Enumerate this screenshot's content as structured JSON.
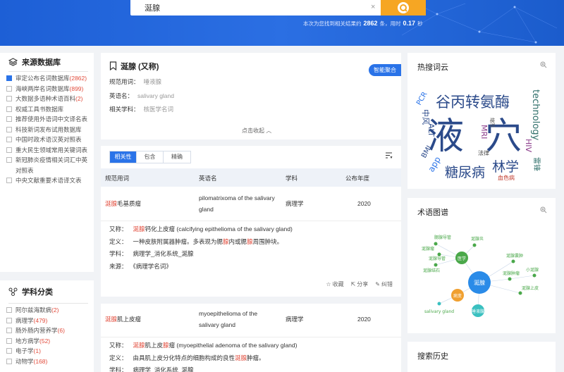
{
  "search": {
    "value": "涎腺",
    "clear": "×"
  },
  "stats": {
    "prefix": "本次为您找到相关结果约",
    "count": "2862",
    "mid": "条，用时",
    "time": "0.17",
    "suffix": "秒"
  },
  "sources": {
    "title": "来源数据库",
    "items": [
      {
        "label": "审定公布名词数据库",
        "count": "(2862)",
        "checked": true
      },
      {
        "label": "海峡两岸名词数据库",
        "count": "(899)",
        "checked": false
      },
      {
        "label": "大数据多语种术语百科",
        "count": "(2)",
        "checked": false
      },
      {
        "label": "权威工具书数据库",
        "count": "",
        "checked": false
      },
      {
        "label": "推荐使用外语词中文译名表",
        "count": "",
        "checked": false
      },
      {
        "label": "科技新词发布试用数据库",
        "count": "",
        "checked": false
      },
      {
        "label": "中国时政术语汉英对照表",
        "count": "",
        "checked": false
      },
      {
        "label": "重大民生领域常用关键词表",
        "count": "",
        "checked": false
      },
      {
        "label": "新冠肺炎疫情相关词汇中英对照表",
        "count": "",
        "checked": false
      },
      {
        "label": "中央文献重要术语译文表",
        "count": "",
        "checked": false
      }
    ]
  },
  "subjects": {
    "title": "学科分类",
    "items": [
      {
        "label": "阿尔兹海默病",
        "count": "(2)"
      },
      {
        "label": "病理学",
        "count": "(479)"
      },
      {
        "label": "肠外肠内营养学",
        "count": "(6)"
      },
      {
        "label": "地方病学",
        "count": "(52)"
      },
      {
        "label": "电子学",
        "count": "(1)"
      },
      {
        "label": "动物学",
        "count": "(168)"
      }
    ]
  },
  "term": {
    "title": "涎腺 (又称)",
    "smart": "智能聚合",
    "rows": [
      {
        "k": "规范用词：",
        "v": "唾液腺"
      },
      {
        "k": "英语名：",
        "v": "salivary gland"
      },
      {
        "k": "相关学科：",
        "v": "核医学名词"
      }
    ],
    "collapse": "点击收起"
  },
  "results": {
    "tabs": [
      "相关性",
      "包含",
      "精确"
    ],
    "headers": [
      "规范用词",
      "英语名",
      "学科",
      "公布年度"
    ],
    "items": [
      {
        "term_hl": "涎腺",
        "term_rest": "毛基质瘤",
        "english": "pilomatrixoma of the salivary gland",
        "subject": "病理学",
        "year": "2020",
        "alias_label": "又称：",
        "alias_hl": "涎腺",
        "alias_rest": "钙化上皮瘤 (calcifying epithelioma of the salivary gland)",
        "def_label": "定义：",
        "def_a": "一种皮肤附属器肿瘤。多表现为腮",
        "def_b": "腺",
        "def_c": "内或腮",
        "def_d": "腺",
        "def_e": "周围肿块。",
        "subj_label": "学科：",
        "subj_val": "病理学_消化系统_涎腺",
        "src_label": "来源：",
        "src_val": "《病理学名词》",
        "fav": "收藏",
        "share": "分享",
        "err": "纠错"
      },
      {
        "term_hl": "涎腺",
        "term_rest": "肌上皮瘤",
        "english": "myoepithelioma of the salivary gland",
        "subject": "病理学",
        "year": "2020",
        "alias_label": "又称：",
        "alias_hl": "涎腺",
        "alias_mid": "肌上皮",
        "alias_hl2": "腺",
        "alias_rest": "瘤 (myoepithelial adenoma of the salivary gland)",
        "def_label": "定义：",
        "def_a": "由具肌上皮分化特点的细胞构成的良性",
        "def_b": "涎腺",
        "def_c": "肿瘤。",
        "subj_label": "学科：",
        "subj_val": "病理学_消化系统_涎腺"
      }
    ]
  },
  "hot": {
    "title": "热搜词云",
    "words": [
      "谷丙转氨酶",
      "液",
      "穴",
      "technology",
      "糖尿病",
      "林学",
      "PCR",
      "中风",
      "ALT",
      "MRI",
      "HIV",
      "app",
      "BMI",
      "法律",
      "血色病",
      "雷锋",
      "缩写"
    ]
  },
  "graph": {
    "title": "术语图谱",
    "center": "涎腺",
    "nodes": [
      "医学",
      "病变",
      "唾液腺",
      "salivary gland",
      "腮腺导管",
      "涎腺瘤",
      "涎腺导管",
      "涎腺结石",
      "涎腺炎",
      "涎腺囊肿",
      "涎腺肿瘤",
      "涎腺上皮",
      "小涎腺"
    ]
  },
  "history": {
    "title": "搜索历史"
  },
  "colors": {
    "accent": "#2a73e8",
    "highlight": "#e24d3d",
    "search_btn": "#f6a623"
  }
}
